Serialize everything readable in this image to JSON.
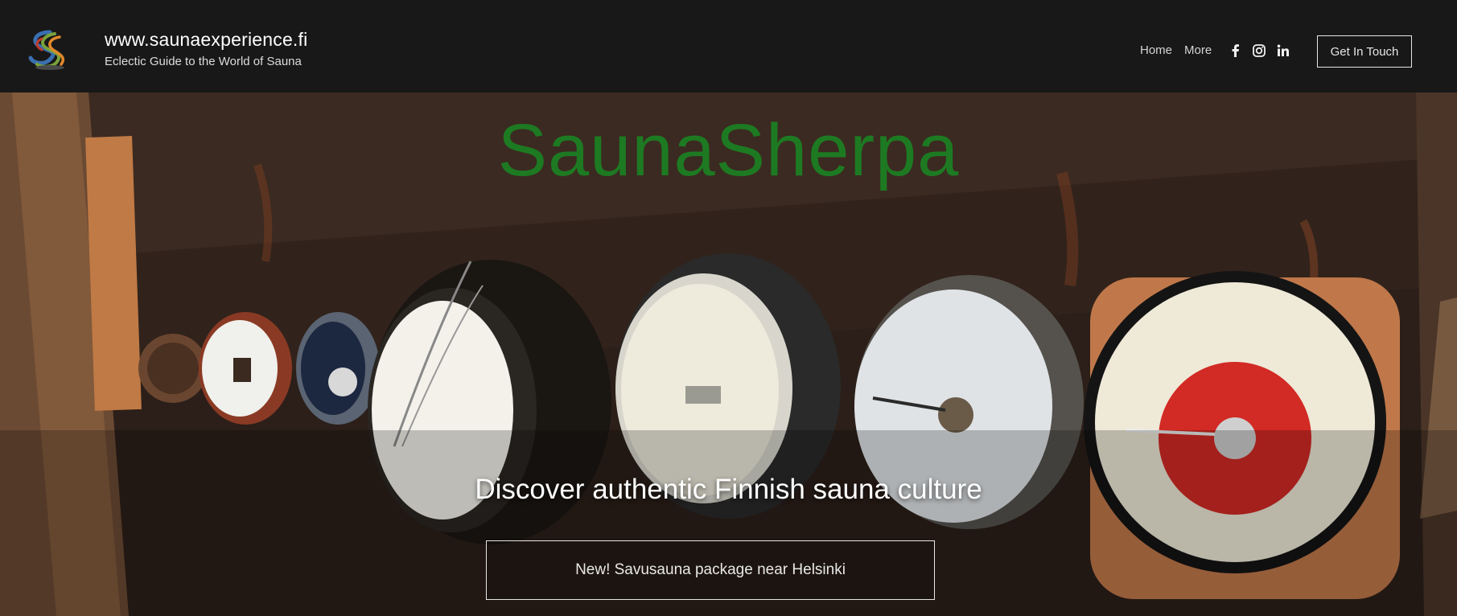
{
  "header": {
    "site_title": "www.saunaexperience.fi",
    "tagline": "Eclectic Guide to the World of Sauna",
    "nav": [
      {
        "label": "Home"
      },
      {
        "label": "More"
      }
    ],
    "social_icons": [
      "facebook-icon",
      "instagram-icon",
      "linkedin-icon"
    ],
    "cta_label": "Get In Touch"
  },
  "hero": {
    "title": "SaunaSherpa",
    "subtitle": "Discover authentic Finnish sauna culture",
    "button_label": "New! Savusauna package near Helsinki"
  },
  "colors": {
    "header_bg": "#181818",
    "title_green": "#1d7a22",
    "text_white": "#ffffff"
  }
}
